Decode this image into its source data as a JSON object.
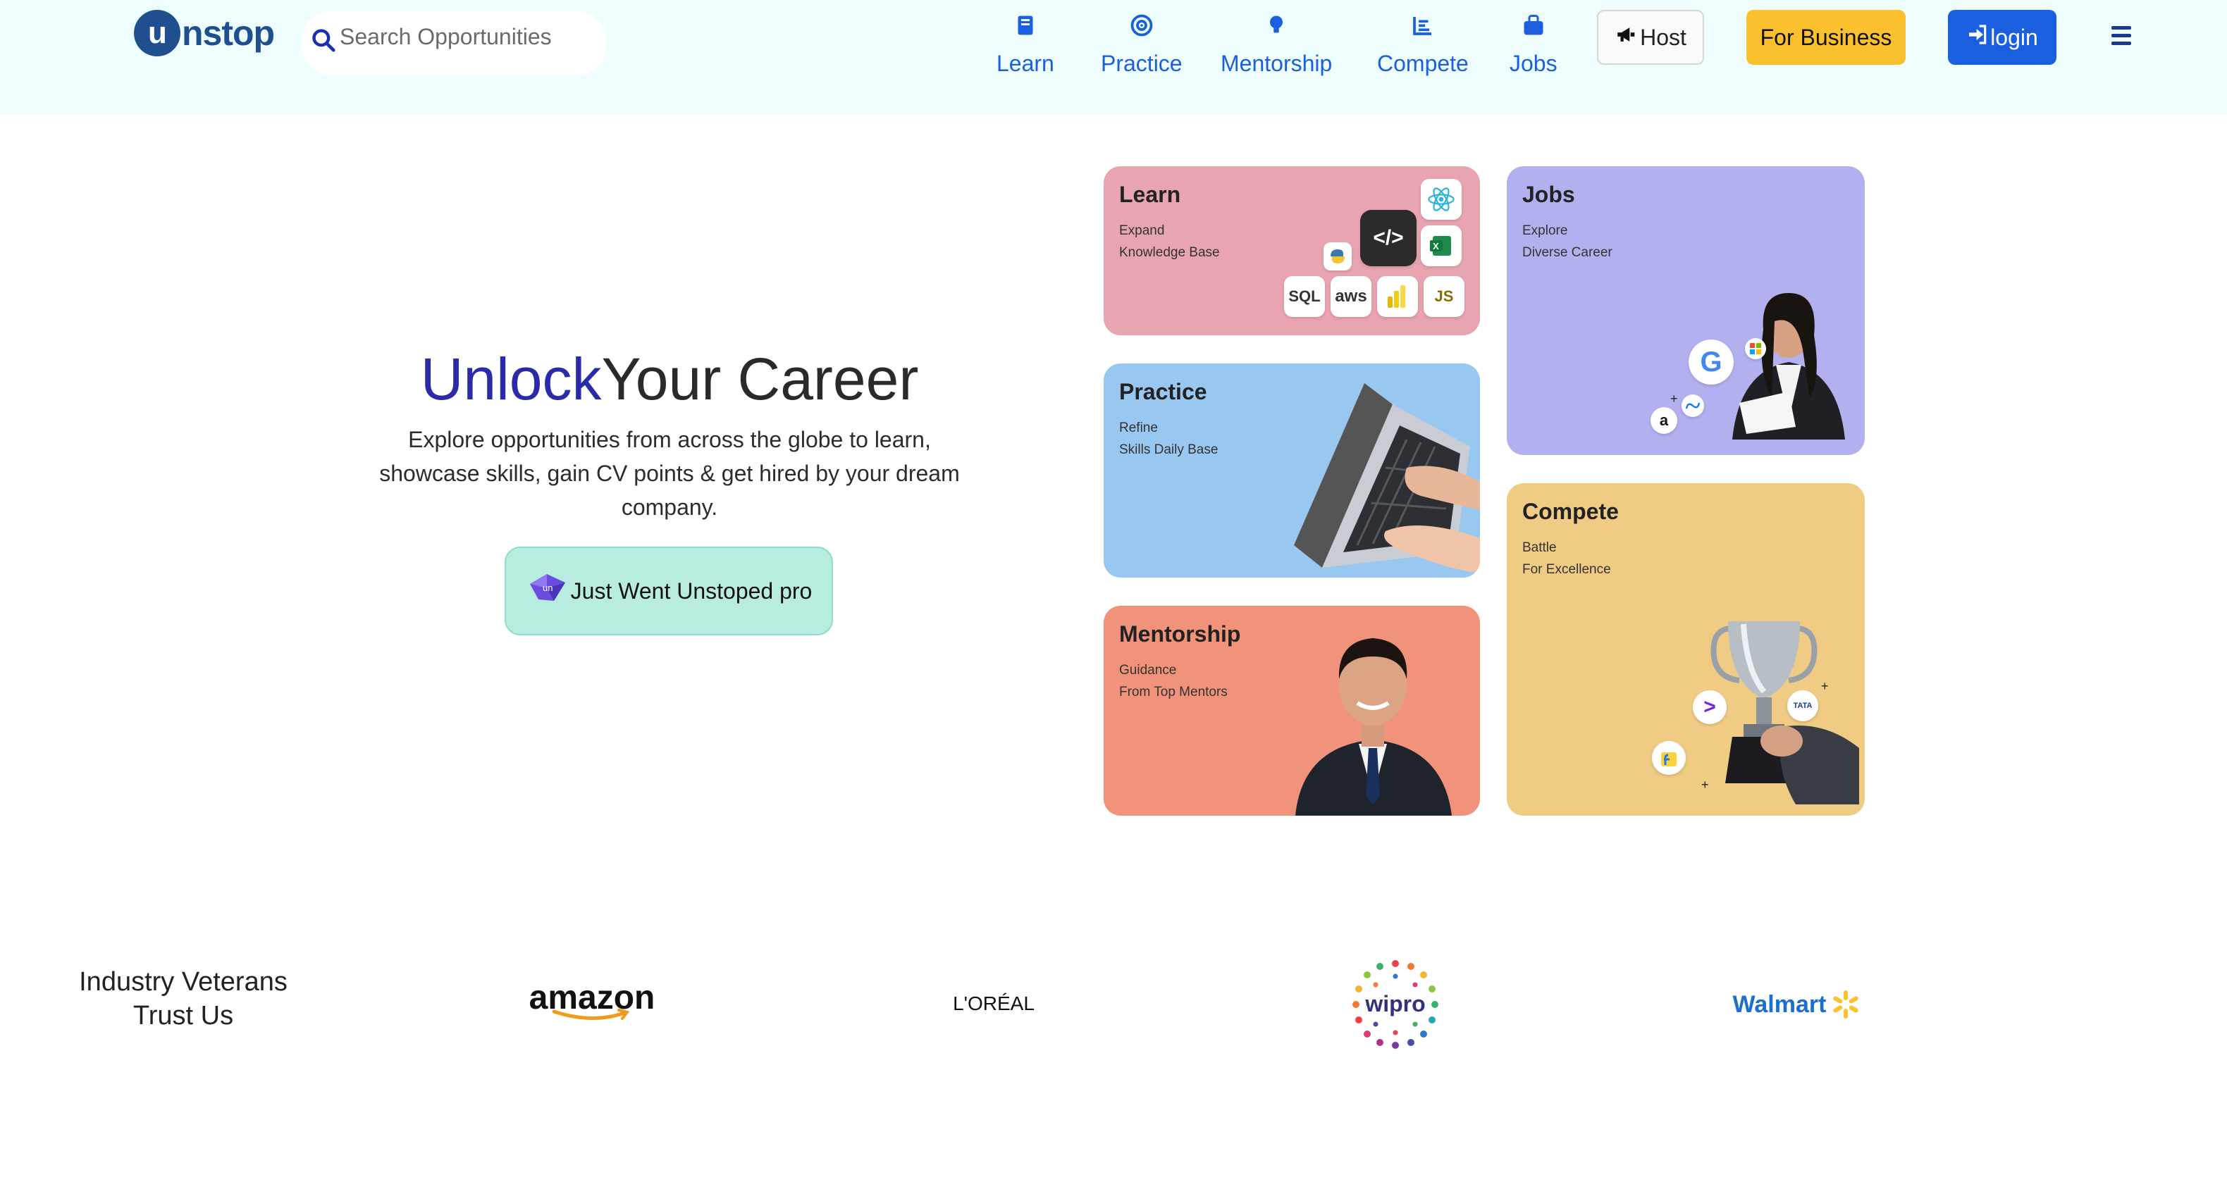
{
  "header": {
    "logo_text": "nstop",
    "logo_mark": "u",
    "search_placeholder": "Search Opportunities",
    "nav": [
      {
        "label": "Learn",
        "icon": "book-icon"
      },
      {
        "label": "Practice",
        "icon": "target-icon"
      },
      {
        "label": "Mentorship",
        "icon": "lightbulb-icon"
      },
      {
        "label": "Compete",
        "icon": "chart-icon"
      },
      {
        "label": "Jobs",
        "icon": "briefcase-icon"
      }
    ],
    "host_label": "Host",
    "business_label": "For Business",
    "login_label": "login",
    "colors": {
      "header_bg": "#eefdfd",
      "nav_blue": "#1a5fe0",
      "business": "#fbc02d"
    }
  },
  "hero": {
    "title_accent": "Unlock",
    "title_rest": "Your Career",
    "description": "Explore opportunities from across the globe to learn, showcase skills, gain CV points & get hired by your dream company.",
    "pro_button": "Just Went Unstoped pro",
    "pro_badge": "un",
    "accent_color": "#2b2aa8"
  },
  "cards": {
    "learn": {
      "title": "Learn",
      "line1": "Expand",
      "line2": "Knowledge Base",
      "tiles": [
        "</>",
        "SQL",
        "aws",
        "JS"
      ]
    },
    "practice": {
      "title": "Practice",
      "line1": "Refine",
      "line2": "Skills Daily Base"
    },
    "mentorship": {
      "title": "Mentorship",
      "line1": "Guidance",
      "line2": "From Top Mentors"
    },
    "jobs": {
      "title": "Jobs",
      "line1": "Explore",
      "line2": "Diverse Career",
      "logos": [
        "G",
        "a"
      ]
    },
    "compete": {
      "title": "Compete",
      "line1": "Battle",
      "line2": "For Excellence",
      "logos": [
        ">",
        "TATA"
      ]
    }
  },
  "trust": {
    "title_line1": "Industry Veterans",
    "title_line2": "Trust Us",
    "brands": [
      "amazon",
      "L'ORÉAL",
      "wipro",
      "Walmart"
    ]
  }
}
